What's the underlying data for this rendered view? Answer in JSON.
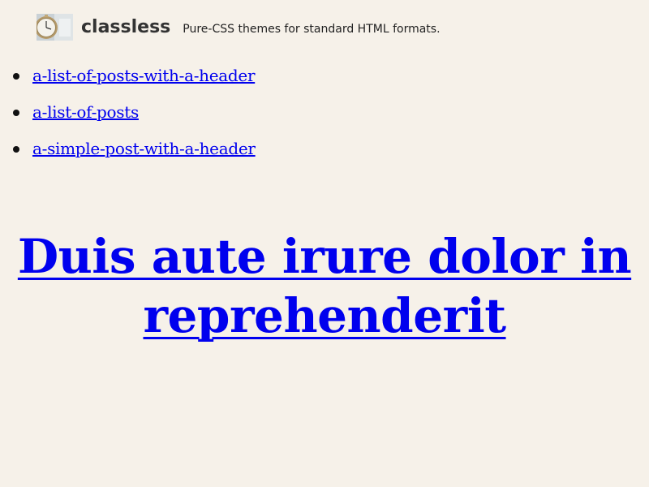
{
  "header": {
    "logo_icon": "clock-photo-thumbnail",
    "title": "classless",
    "tagline": "Pure-CSS themes for standard HTML formats."
  },
  "nav": {
    "items": [
      {
        "label": "a-list-of-posts-with-a-header"
      },
      {
        "label": "a-list-of-posts"
      },
      {
        "label": "a-simple-post-with-a-header"
      }
    ]
  },
  "article": {
    "headline": "Duis aute irure dolor in reprehenderit"
  },
  "colors": {
    "background": "#f6f1e9",
    "link": "#0000ee",
    "title": "#333333"
  }
}
